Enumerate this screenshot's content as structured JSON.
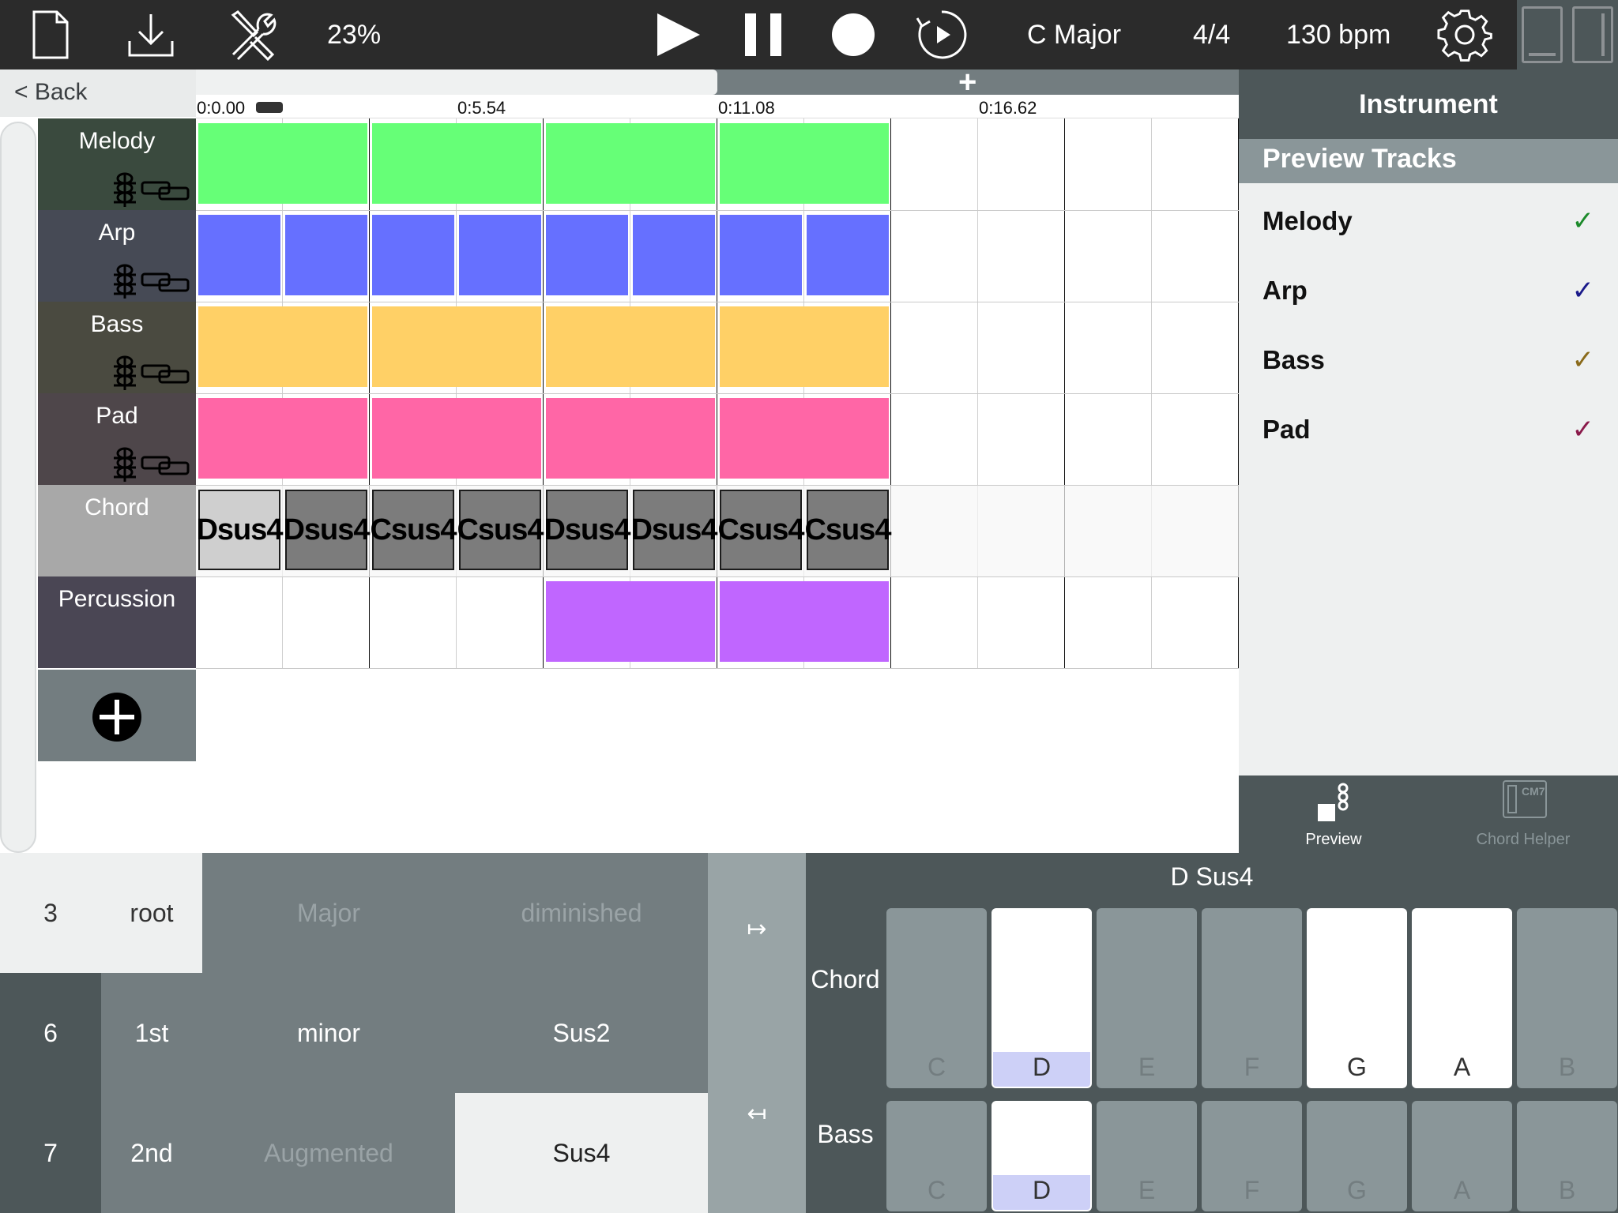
{
  "toolbar": {
    "zoom": "23%",
    "key_signature": "C Major",
    "time_signature": "4/4",
    "tempo": "130 bpm"
  },
  "nav": {
    "back_label": "< Back"
  },
  "timeline": {
    "ticks": [
      "0:0.00",
      "0:5.54",
      "0:11.08",
      "0:16.62"
    ],
    "add_label": "+"
  },
  "tracks": [
    {
      "name": "Melody",
      "color": "#66ff77",
      "header_color": "#3a4a3e"
    },
    {
      "name": "Arp",
      "color": "#6670ff",
      "header_color": "#464a55"
    },
    {
      "name": "Bass",
      "color": "#ffd066",
      "header_color": "#4a4a40"
    },
    {
      "name": "Pad",
      "color": "#ff66a6",
      "header_color": "#4e464a"
    },
    {
      "name": "Chord",
      "color": "#7c7c7c",
      "header_color": "#a8a8a8"
    },
    {
      "name": "Percussion",
      "color": "#c066ff",
      "header_color": "#4a4654"
    }
  ],
  "chords": [
    "Dsus4",
    "Dsus4",
    "Csus4",
    "Csus4",
    "Dsus4",
    "Dsus4",
    "Csus4",
    "Csus4"
  ],
  "instrument_panel": {
    "title": "Instrument",
    "section": "Preview Tracks",
    "preview_tracks": [
      {
        "name": "Melody",
        "check": "✓",
        "check_color": "#1b8a2a"
      },
      {
        "name": "Arp",
        "check": "✓",
        "check_color": "#1a1a8a"
      },
      {
        "name": "Bass",
        "check": "✓",
        "check_color": "#8a6a1a"
      },
      {
        "name": "Pad",
        "check": "✓",
        "check_color": "#8a1a4a"
      }
    ],
    "tabs": [
      {
        "label": "Preview",
        "active": true
      },
      {
        "label": "Chord Helper",
        "active": false
      }
    ],
    "chord_icon_text": "CM7"
  },
  "chord_builder": {
    "extensions": [
      "3",
      "6",
      "7"
    ],
    "inversions": [
      "root",
      "1st",
      "2nd"
    ],
    "qualities": [
      {
        "label": "Major",
        "enabled": false
      },
      {
        "label": "diminished",
        "enabled": false
      },
      {
        "label": "minor",
        "enabled": true
      },
      {
        "label": "Sus2",
        "enabled": true
      },
      {
        "label": "Augmented",
        "enabled": false
      },
      {
        "label": "Sus4",
        "enabled": true,
        "selected": true
      }
    ],
    "arrow_right": "↦",
    "arrow_left": "↤"
  },
  "keyboard": {
    "title": "D Sus4",
    "chord_label": "Chord",
    "bass_label": "Bass",
    "notes": [
      "C",
      "D",
      "E",
      "F",
      "G",
      "A",
      "B"
    ],
    "chord_notes": [
      "D",
      "G",
      "A"
    ],
    "chord_root": "D",
    "bass_note": "D"
  }
}
